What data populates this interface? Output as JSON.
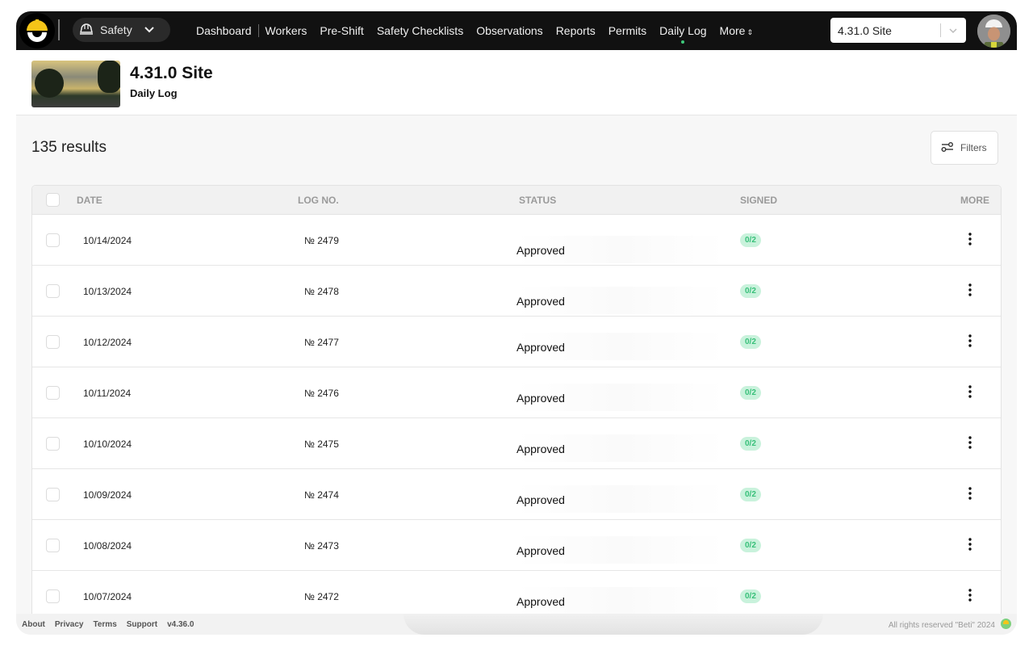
{
  "topbar": {
    "logo_icon": "hardhat-logo-icon",
    "module": {
      "icon": "hardhat-icon",
      "label": "Safety",
      "chevron": "chevron-down-icon"
    },
    "nav": [
      {
        "label": "Dashboard",
        "active": false
      },
      {
        "label": "Workers",
        "active": false
      },
      {
        "label": "Pre-Shift",
        "active": false
      },
      {
        "label": "Safety Checklists",
        "active": false
      },
      {
        "label": "Observations",
        "active": false
      },
      {
        "label": "Reports",
        "active": false
      },
      {
        "label": "Permits",
        "active": false
      },
      {
        "label": "Daily Log",
        "active": true
      },
      {
        "label": "More",
        "active": false,
        "icon": "sort-icon"
      }
    ],
    "site_select": {
      "value": "4.31.0 Site"
    },
    "avatar_alt": "user-avatar"
  },
  "header": {
    "title": "4.31.0 Site",
    "subtitle": "Daily Log"
  },
  "toolbar": {
    "results": "135 results",
    "filters_label": "Filters"
  },
  "table": {
    "columns": [
      "DATE",
      "LOG NO.",
      "STATUS",
      "SIGNED",
      "MORE"
    ],
    "rows": [
      {
        "date": "10/14/2024",
        "log_no": "№ 2479",
        "status": "Approved",
        "signed": "0/2"
      },
      {
        "date": "10/13/2024",
        "log_no": "№ 2478",
        "status": "Approved",
        "signed": "0/2"
      },
      {
        "date": "10/12/2024",
        "log_no": "№ 2477",
        "status": "Approved",
        "signed": "0/2"
      },
      {
        "date": "10/11/2024",
        "log_no": "№ 2476",
        "status": "Approved",
        "signed": "0/2"
      },
      {
        "date": "10/10/2024",
        "log_no": "№ 2475",
        "status": "Approved",
        "signed": "0/2"
      },
      {
        "date": "10/09/2024",
        "log_no": "№ 2474",
        "status": "Approved",
        "signed": "0/2"
      },
      {
        "date": "10/08/2024",
        "log_no": "№ 2473",
        "status": "Approved",
        "signed": "0/2"
      },
      {
        "date": "10/07/2024",
        "log_no": "№ 2472",
        "status": "Approved",
        "signed": "0/2"
      }
    ]
  },
  "footer": {
    "links": [
      "About",
      "Privacy",
      "Terms",
      "Support"
    ],
    "version": "v4.36.0",
    "copyright": "All rights reserved \"Beti\" 2024"
  },
  "colors": {
    "topbar_bg": "#111111",
    "accent_yellow": "#f5c518",
    "active_dot": "#3ec97a",
    "badge_bg": "#c9f2dc",
    "badge_text": "#39c07a"
  }
}
